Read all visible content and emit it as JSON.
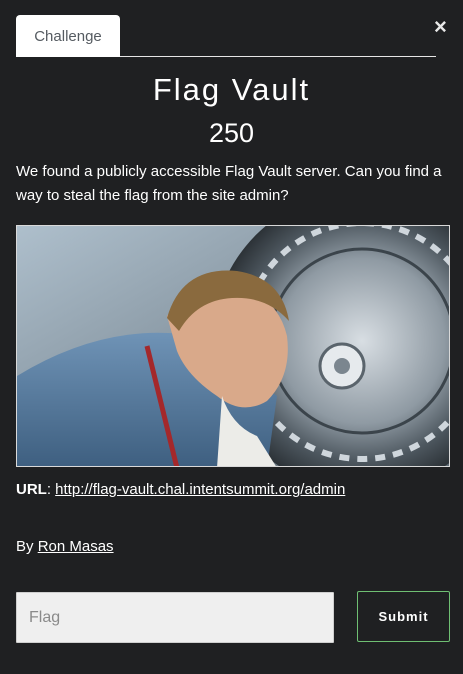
{
  "modal": {
    "close_glyph": "×",
    "tab_label": "Challenge",
    "title": "Flag Vault",
    "points": "250",
    "description": "We found a publicly accessible Flag Vault server. Can you find a way to steal the flag from the site admin?",
    "url_label": "URL",
    "url_sep": ":",
    "url": "http://flag-vault.chal.intentsummit.org/admin",
    "by_label": "By",
    "author": "Ron Masas",
    "flag_placeholder": "Flag",
    "submit_label": "Submit"
  },
  "colors": {
    "background": "#1f2022",
    "tab_bg": "#ffffff",
    "submit_border": "#6fbf73",
    "input_bg": "#efefef"
  }
}
